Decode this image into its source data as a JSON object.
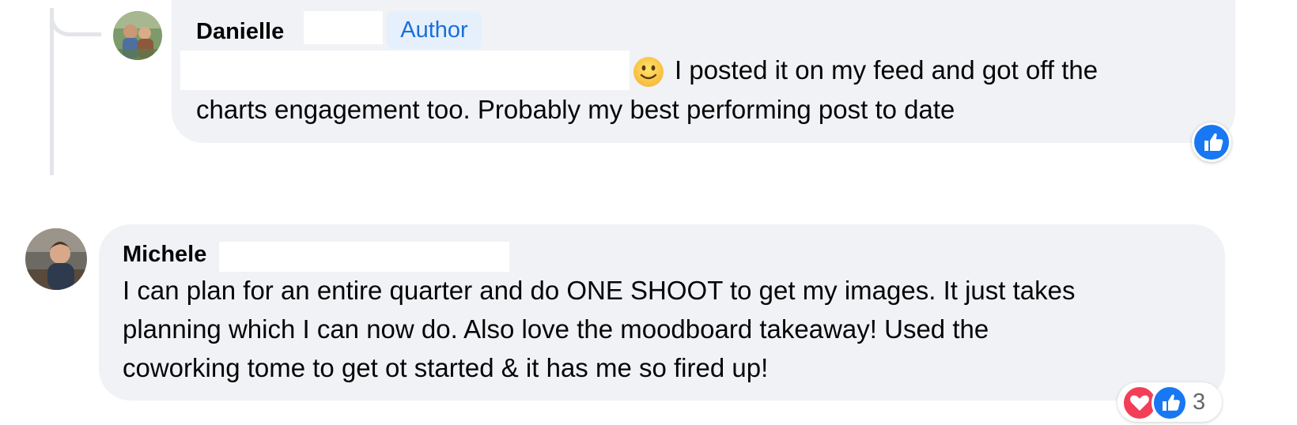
{
  "comments": [
    {
      "author": "Danielle",
      "badge": "Author",
      "text_line_1": "I posted it on my feed and got off the",
      "text_line_2": "charts engagement too. Probably my best performing post to date",
      "emoji": "slightly-smiling-face",
      "reactions": [
        "like"
      ]
    },
    {
      "author": "Michele",
      "text_line_1": "I can plan for an entire quarter and do ONE SHOOT to get my images. It just takes",
      "text_line_2": "planning which I can now do. Also love the moodboard takeaway! Used the",
      "text_line_3": "coworking tome to get ot started & it has me so fired up!",
      "reactions": [
        "love",
        "like"
      ],
      "reaction_count": "3"
    }
  ],
  "colors": {
    "bubble_bg": "#f0f2f5",
    "badge_bg": "#e6f0fd",
    "badge_text": "#1a6fd8",
    "like_blue": "#1877f2",
    "love_red": "#f33e58",
    "muted_text": "#65676b"
  }
}
